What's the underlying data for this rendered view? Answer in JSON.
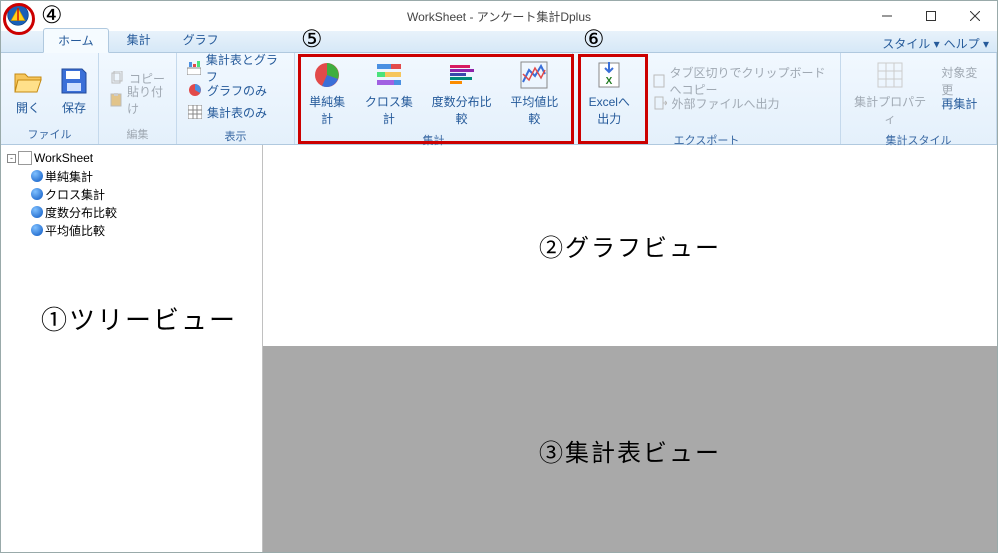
{
  "titlebar": {
    "title": "WorkSheet - アンケート集計Dplus"
  },
  "tabs": {
    "items": [
      "ホーム",
      "集計",
      "グラフ"
    ],
    "active": 0
  },
  "right_menu": {
    "style": "スタイル",
    "help": "ヘルプ"
  },
  "ribbon": {
    "file": {
      "label": "ファイル",
      "open": "開く",
      "save": "保存"
    },
    "edit": {
      "label": "編集",
      "copy": "コピー",
      "paste": "貼り付け"
    },
    "display": {
      "label": "表示",
      "both": "集計表とグラフ",
      "graph_only": "グラフのみ",
      "table_only": "集計表のみ"
    },
    "tabulation": {
      "label": "集計",
      "simple": "単純集計",
      "cross": "クロス集計",
      "freq": "度数分布比較",
      "mean": "平均値比較"
    },
    "export": {
      "label": "エクスポート",
      "excel": "Excelへ出力",
      "clip": "タブ区切りでクリップボードへコピー",
      "extfile": "外部ファイルへ出力"
    },
    "style": {
      "label": "集計スタイル",
      "props": "集計プロパティ",
      "target": "対象変更",
      "retab": "再集計"
    }
  },
  "tree": {
    "root": "WorkSheet",
    "items": [
      "単純集計",
      "クロス集計",
      "度数分布比較",
      "平均値比較"
    ]
  },
  "annotations": {
    "tree_view": "①ツリービュー",
    "graph_view": "②グラフビュー",
    "table_view": "③集計表ビュー",
    "c4": "④",
    "c5": "⑤",
    "c6": "⑥"
  }
}
